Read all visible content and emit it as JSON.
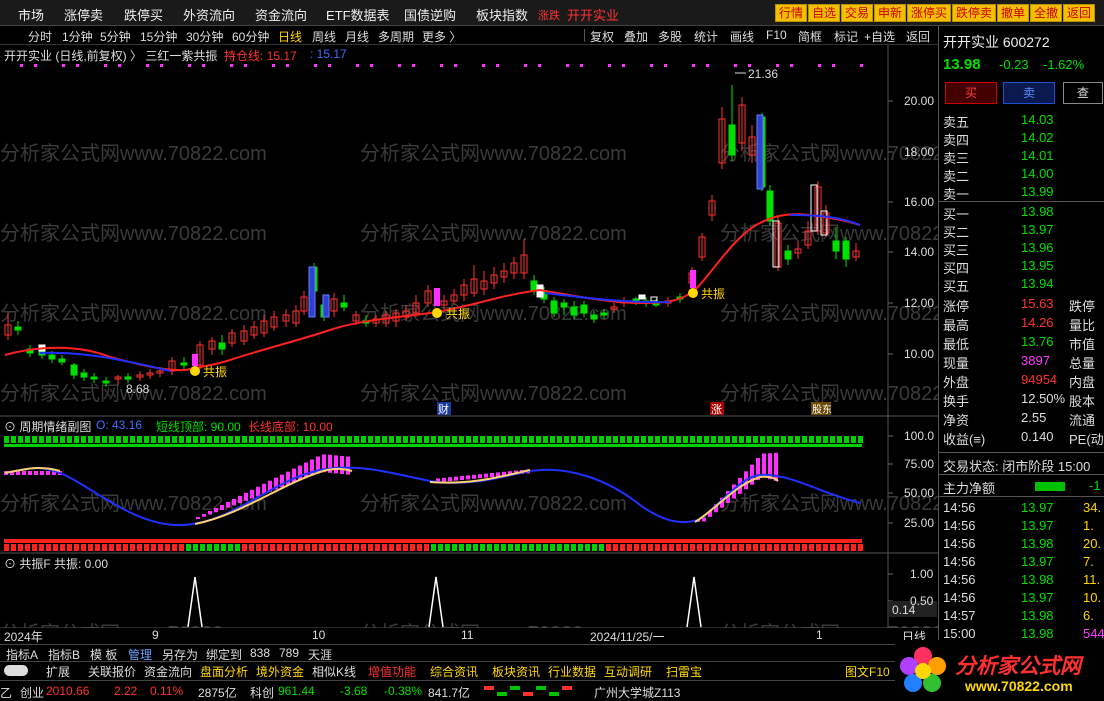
{
  "nav": [
    "市场",
    "涨停卖",
    "跌停买",
    "外资流向",
    "资金流向",
    "ETF数据表",
    "国债逆购",
    "板块指数"
  ],
  "nav_red1": "涨跌",
  "nav_red2": "开开实业",
  "top_buttons": [
    "行情",
    "自选",
    "交易",
    "申新",
    "涨停买",
    "跌停卖",
    "撤单",
    "全撤",
    "返回"
  ],
  "periods": [
    "分时",
    "1分钟",
    "5分钟",
    "15分钟",
    "30分钟",
    "60分钟",
    "日线",
    "周线",
    "月线",
    "多周期",
    "更多 〉"
  ],
  "tools": [
    "复权",
    "叠加",
    "多股",
    "统计",
    "画线",
    "F10",
    "简框",
    "标记",
    "+自选",
    "返回"
  ],
  "chart_title": "开开实业 (日线,前复权) 〉 三红一紫共振",
  "chart_ind1": "持仓线: 15.17",
  "chart_ind2": ": 15.17",
  "price_labels": [
    "20.00",
    "18.00",
    "16.00",
    "14.00",
    "12.00",
    "10.00"
  ],
  "high_label": "21.36",
  "low_label": "8.68",
  "resonance_label": "共振",
  "event_tags": [
    "财",
    "涨",
    "股东"
  ],
  "watermark": "分析家公式网www.70822.com",
  "sub1_title": "周期情绪副图",
  "sub1_o": "O: 43.16",
  "sub1_short": "短线顶部: 90.00",
  "sub1_long": "长线底部: 10.00",
  "sub1_labels": [
    "100.0",
    "75.00",
    "50.00",
    "25.00"
  ],
  "sub2_title": "共振F 共振: 0.00",
  "sub2_labels": [
    "1.00",
    "0.50"
  ],
  "sub2_value": "0.14",
  "dates": [
    "2024年",
    "9",
    "10",
    "11",
    "2024/11/25/一",
    "1"
  ],
  "date_period": "日线",
  "stock": {
    "name": "开开实业",
    "code": "600272",
    "price": "13.98",
    "change": "-0.23",
    "pct": "-1.62%"
  },
  "trade_buttons": [
    "买",
    "卖",
    "查"
  ],
  "asks": [
    {
      "label": "卖五",
      "price": "14.03"
    },
    {
      "label": "卖四",
      "price": "14.02"
    },
    {
      "label": "卖三",
      "price": "14.01"
    },
    {
      "label": "卖二",
      "price": "14.00"
    },
    {
      "label": "卖一",
      "price": "13.99"
    }
  ],
  "bids": [
    {
      "label": "买一",
      "price": "13.98"
    },
    {
      "label": "买二",
      "price": "13.97"
    },
    {
      "label": "买三",
      "price": "13.96"
    },
    {
      "label": "买四",
      "price": "13.95"
    },
    {
      "label": "买五",
      "price": "13.94"
    }
  ],
  "stats": [
    {
      "l": "涨停",
      "v": "15.63",
      "l2": "跌停"
    },
    {
      "l": "最高",
      "v": "14.26",
      "l2": "量比"
    },
    {
      "l": "最低",
      "v": "13.76",
      "l2": "市值"
    },
    {
      "l": "现量",
      "v": "3897",
      "l2": "总量"
    },
    {
      "l": "外盘",
      "v": "94954",
      "l2": "内盘"
    },
    {
      "l": "换手",
      "v": "12.50%",
      "l2": "股本"
    },
    {
      "l": "净资",
      "v": "2.55",
      "l2": "流通"
    },
    {
      "l": "收益(≡)",
      "v": "0.140",
      "l2": "PE(动"
    }
  ],
  "trade_status": "交易状态: 闭市阶段 15:00",
  "main_flow": "主力净额",
  "main_flow_val": "-1",
  "ticks": [
    {
      "t": "14:56",
      "p": "13.97",
      "v": "34."
    },
    {
      "t": "14:56",
      "p": "13.97",
      "v": "1."
    },
    {
      "t": "14:56",
      "p": "13.98",
      "v": "20."
    },
    {
      "t": "14:56",
      "p": "13.97",
      "v": "7."
    },
    {
      "t": "14:56",
      "p": "13.98",
      "v": "11."
    },
    {
      "t": "14:56",
      "p": "13.97",
      "v": "10."
    },
    {
      "t": "14:57",
      "p": "13.98",
      "v": "6."
    },
    {
      "t": "15:00",
      "p": "13.98",
      "v": "544."
    }
  ],
  "bottom_tabs": [
    "指标A",
    "指标B",
    "模 板",
    "管理",
    "另存为",
    "绑定到",
    "838",
    "789",
    "天涯"
  ],
  "func_tabs": [
    "扩展",
    "关联报价",
    "资金流向",
    "盘面分析",
    "境外资金",
    "相似K线",
    "增值功能",
    "综合资讯",
    "板块资讯",
    "行业数据",
    "互动调研",
    "扫雷宝"
  ],
  "f10_label": "图文F10",
  "index_bar": {
    "pre": "乙",
    "name": "创业",
    "val": "2010.66",
    "chg": "2.22",
    "pct": "0.11%",
    "amt": "2875亿",
    "name2": "科创",
    "val2": "961.44",
    "chg2": "-3.68",
    "pct2": "-0.38%",
    "amt2": "841.7亿",
    "city": "广州大学城Z113"
  },
  "logo_text": "分析家公式网",
  "logo_url": "www.70822.com",
  "colors": {
    "up": "#ff3232",
    "down": "#00e000",
    "ma_red": "#ff2020",
    "ma_blue": "#2030ff",
    "accent": "#ffd700"
  }
}
